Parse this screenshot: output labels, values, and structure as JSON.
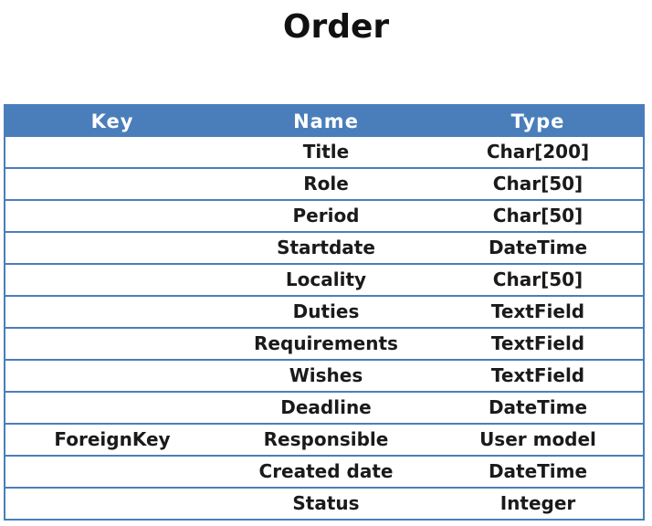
{
  "page": {
    "title": "Order"
  },
  "table": {
    "headers": [
      "Key",
      "Name",
      "Type"
    ],
    "rows": [
      {
        "key": "",
        "name": "Title",
        "type": "Char[200]"
      },
      {
        "key": "",
        "name": "Role",
        "type": "Char[50]"
      },
      {
        "key": "",
        "name": "Period",
        "type": "Char[50]"
      },
      {
        "key": "",
        "name": "Startdate",
        "type": "DateTime"
      },
      {
        "key": "",
        "name": "Locality",
        "type": "Char[50]"
      },
      {
        "key": "",
        "name": "Duties",
        "type": "TextField"
      },
      {
        "key": "",
        "name": "Requirements",
        "type": "TextField"
      },
      {
        "key": "",
        "name": "Wishes",
        "type": "TextField"
      },
      {
        "key": "",
        "name": "Deadline",
        "type": "DateTime"
      },
      {
        "key": "ForeignKey",
        "name": "Responsible",
        "type": "User model"
      },
      {
        "key": "",
        "name": "Created date",
        "type": "DateTime"
      },
      {
        "key": "",
        "name": "Status",
        "type": "Integer"
      }
    ]
  },
  "colors": {
    "header_bg": "#4a7ebb",
    "header_text": "#ffffff",
    "border": "#4a7ebb"
  }
}
